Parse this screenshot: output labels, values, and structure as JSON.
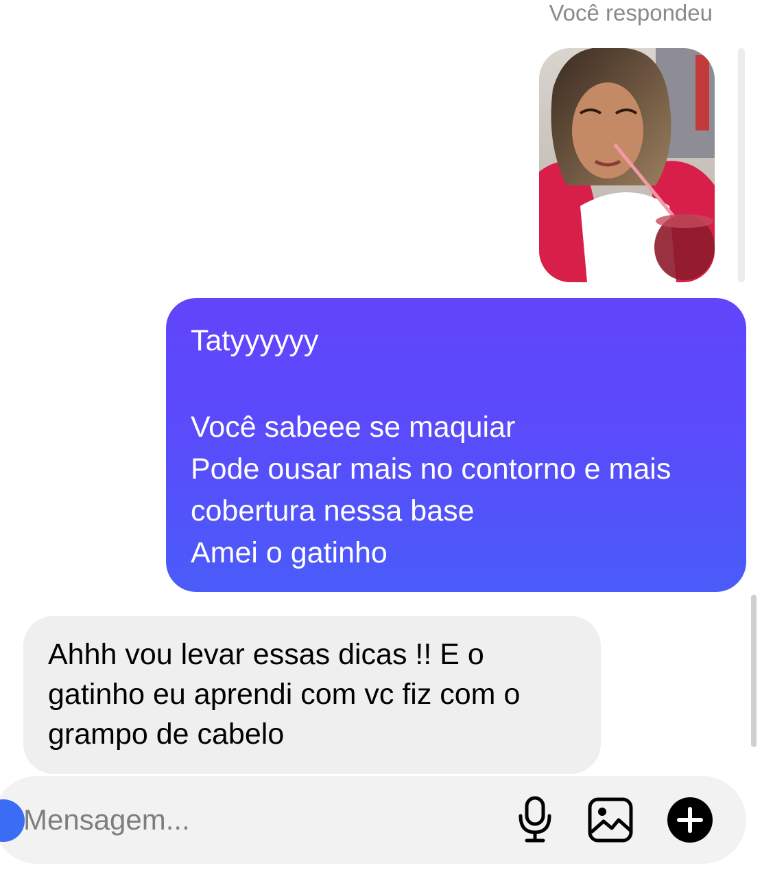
{
  "reply_context": {
    "label": "Você respondeu"
  },
  "messages": [
    {
      "direction": "sent",
      "lines": [
        "Tatyyyyyy",
        "",
        "Você sabeee  se maquiar",
        "Pode ousar mais no contorno e mais",
        "cobertura nessa base",
        "Amei o gatinho"
      ]
    },
    {
      "direction": "received",
      "lines": [
        "Ahhh vou levar essas dicas !! E o",
        "gatinho eu aprendi com vc fiz com o",
        "grampo de cabelo"
      ]
    }
  ],
  "composer": {
    "placeholder": "Mensagem...",
    "icons": [
      "microphone-icon",
      "gallery-icon",
      "plus-icon"
    ]
  },
  "colors": {
    "sent_bubble_top": "#6145fb",
    "sent_bubble_bottom": "#4a5cf9",
    "received_bubble": "#efefef",
    "composer_bg": "#f2f2f2",
    "camera_button": "#3b6cf6"
  }
}
